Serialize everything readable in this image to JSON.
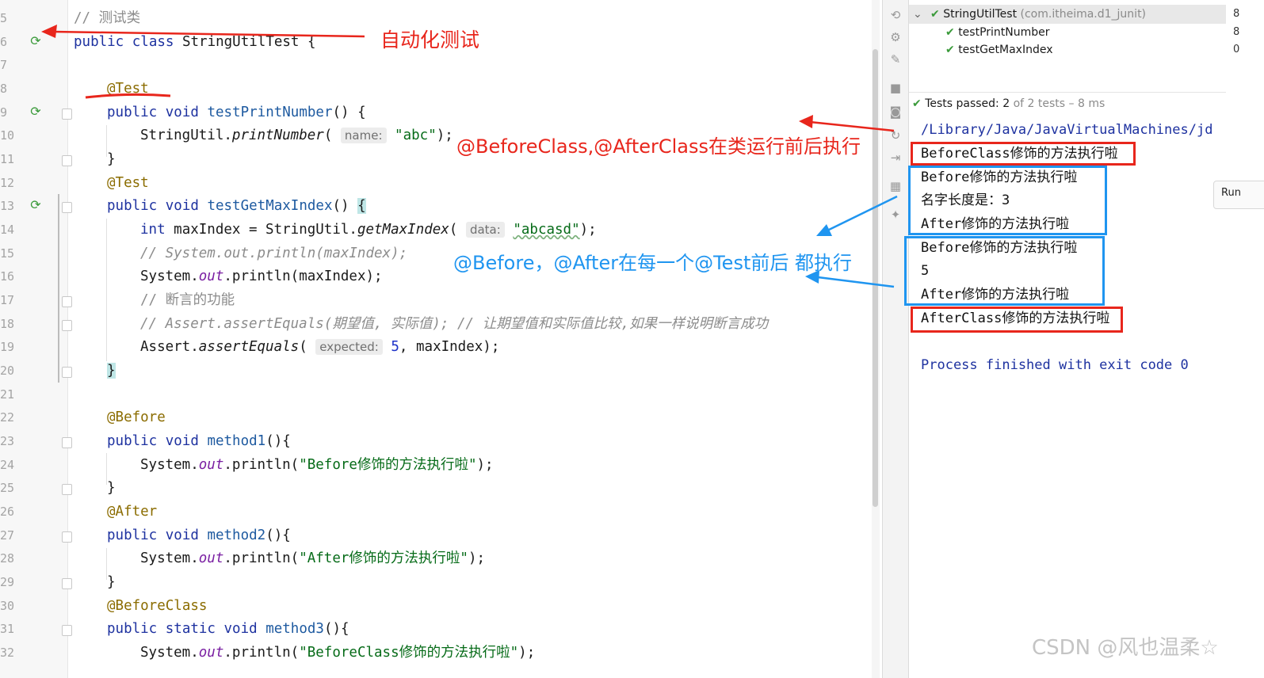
{
  "editor": {
    "line_numbers": [
      "5",
      "6",
      "7",
      "8",
      "9",
      "10",
      "11",
      "12",
      "13",
      "14",
      "15",
      "16",
      "17",
      "18",
      "19",
      "20",
      "21",
      "22",
      "23",
      "24",
      "25",
      "26",
      "27",
      "28",
      "29",
      "30",
      "31",
      "32"
    ],
    "comment_class": "// 测试类",
    "class_decl": {
      "kw": "public class ",
      "name": "StringUtilTest {"
    },
    "ann_test": "@Test",
    "m1_sig": {
      "kw": "public void ",
      "name": "testPrintNumber",
      "rest": "() {"
    },
    "m1_call": {
      "cls": "StringUtil.",
      "fn": "printNumber",
      "open": "(",
      "hint": "name:",
      "arg": "\"abc\"",
      "close": ");"
    },
    "close_brace": "}",
    "m2_sig": {
      "kw": "public void ",
      "name": "testGetMaxIndex",
      "rest": "() ",
      "brace": "{"
    },
    "m2_line1": {
      "kw": "int ",
      "var": "maxIndex = StringUtil.",
      "fn": "getMaxIndex",
      "open": "(",
      "hint": "data:",
      "arg": "\"abcasd\"",
      "close": ");"
    },
    "m2_comment1": "// System.out.println(maxIndex);",
    "m2_print": {
      "pre": "System.",
      "fld": "out",
      "post": ".println(maxIndex);"
    },
    "m2_comment2": "// 断言的功能",
    "m2_comment3": "// Assert.assertEquals(期望值, 实际值); // 让期望值和实际值比较,如果一样说明断言成功",
    "m2_assert": {
      "cls": "Assert.",
      "fn": "assertEquals",
      "open": "(",
      "hint": "expected:",
      "num": "5",
      "close": ", maxIndex);"
    },
    "ann_before": "@Before",
    "m3_sig": {
      "kw": "public void ",
      "name": "method1",
      "rest": "(){"
    },
    "m3_print": {
      "pre": "System.",
      "fld": "out",
      "mid": ".println(",
      "str": "\"Before修饰的方法执行啦\"",
      "close": ");"
    },
    "ann_after": "@After",
    "m4_sig": {
      "kw": "public void ",
      "name": "method2",
      "rest": "(){"
    },
    "m4_print": {
      "pre": "System.",
      "fld": "out",
      "mid": ".println(",
      "str": "\"After修饰的方法执行啦\"",
      "close": ");"
    },
    "ann_beforeclass": "@BeforeClass",
    "m5_sig": {
      "kw": "public static void ",
      "name": "method3",
      "rest": "(){"
    },
    "m5_print": {
      "pre": "System.",
      "fld": "out",
      "mid": ".println(",
      "str": "\"BeforeClass修饰的方法执行啦\"",
      "close": ");"
    }
  },
  "test_tree": {
    "root_label": "StringUtilTest",
    "root_pkg": "(com.itheima.d1_junit)",
    "root_time": "8",
    "items": [
      {
        "label": "testPrintNumber",
        "time": "8"
      },
      {
        "label": "testGetMaxIndex",
        "time": "0"
      }
    ],
    "status_prefix": "Tests passed: ",
    "status_count": "2",
    "status_suffix": " of 2 tests – 8 ms"
  },
  "console": {
    "path": "/Library/Java/JavaVirtualMachines/jd",
    "lines": [
      "BeforeClass修饰的方法执行啦",
      "Before修饰的方法执行啦",
      "名字长度是：3",
      "After修饰的方法执行啦",
      "Before修饰的方法执行啦",
      "5",
      "After修饰的方法执行啦",
      "AfterClass修饰的方法执行啦"
    ],
    "finished": "Process finished with exit code 0"
  },
  "run_tab": "Run",
  "annotations": {
    "auto_test": "自动化测试",
    "before_after_class": "@BeforeClass,@AfterClass在类运行前后执行",
    "before_after": "@Before，@After在每一个@Test前后 都执行"
  },
  "watermark": "CSDN @风也温柔☆",
  "colors": {
    "annotation_red": "#e8261c",
    "annotation_blue": "#1f95f0",
    "run_green": "#3a9a3a"
  }
}
